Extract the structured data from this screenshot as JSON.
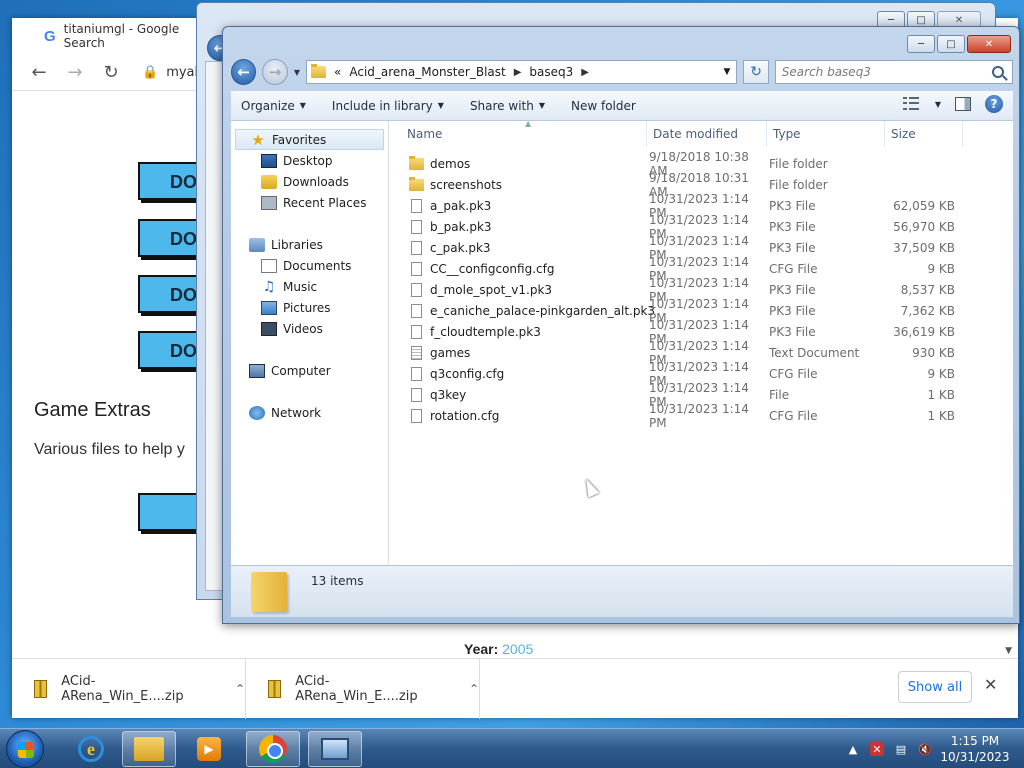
{
  "chrome": {
    "tab_title": "titaniumgl - Google Search",
    "url": "myaba",
    "download_buttons": [
      "DOV",
      "DOV",
      "DOV",
      "DOV"
    ],
    "extras_title": "Game Extras",
    "extras_desc": "Various files to help y",
    "year_label": "Year:",
    "year_value": "2005",
    "downloads": [
      "ACid-ARena_Win_E....zip",
      "ACid-ARena_Win_E....zip"
    ],
    "show_all": "Show all"
  },
  "explorer": {
    "breadcrumb": [
      "«",
      "Acid_arena_Monster_Blast",
      "baseq3"
    ],
    "search_placeholder": "Search baseq3",
    "commands": [
      "Organize",
      "Include in library",
      "Share with",
      "New folder"
    ],
    "nav": {
      "favorites": "Favorites",
      "desktop": "Desktop",
      "downloads": "Downloads",
      "recent": "Recent Places",
      "libraries": "Libraries",
      "documents": "Documents",
      "music": "Music",
      "pictures": "Pictures",
      "videos": "Videos",
      "computer": "Computer",
      "network": "Network"
    },
    "columns": {
      "name": "Name",
      "date": "Date modified",
      "type": "Type",
      "size": "Size"
    },
    "files": [
      {
        "name": "demos",
        "date": "9/18/2018 10:38 AM",
        "type": "File folder",
        "size": "",
        "icon": "folder"
      },
      {
        "name": "screenshots",
        "date": "9/18/2018 10:31 AM",
        "type": "File folder",
        "size": "",
        "icon": "folder"
      },
      {
        "name": "a_pak.pk3",
        "date": "10/31/2023 1:14 PM",
        "type": "PK3 File",
        "size": "62,059 KB",
        "icon": "file"
      },
      {
        "name": "b_pak.pk3",
        "date": "10/31/2023 1:14 PM",
        "type": "PK3 File",
        "size": "56,970 KB",
        "icon": "file"
      },
      {
        "name": "c_pak.pk3",
        "date": "10/31/2023 1:14 PM",
        "type": "PK3 File",
        "size": "37,509 KB",
        "icon": "file"
      },
      {
        "name": "CC__configconfig.cfg",
        "date": "10/31/2023 1:14 PM",
        "type": "CFG File",
        "size": "9 KB",
        "icon": "file"
      },
      {
        "name": "d_mole_spot_v1.pk3",
        "date": "10/31/2023 1:14 PM",
        "type": "PK3 File",
        "size": "8,537 KB",
        "icon": "file"
      },
      {
        "name": "e_caniche_palace-pinkgarden_alt.pk3",
        "date": "10/31/2023 1:14 PM",
        "type": "PK3 File",
        "size": "7,362 KB",
        "icon": "file"
      },
      {
        "name": "f_cloudtemple.pk3",
        "date": "10/31/2023 1:14 PM",
        "type": "PK3 File",
        "size": "36,619 KB",
        "icon": "file"
      },
      {
        "name": "games",
        "date": "10/31/2023 1:14 PM",
        "type": "Text Document",
        "size": "930 KB",
        "icon": "text"
      },
      {
        "name": "q3config.cfg",
        "date": "10/31/2023 1:14 PM",
        "type": "CFG File",
        "size": "9 KB",
        "icon": "file"
      },
      {
        "name": "q3key",
        "date": "10/31/2023 1:14 PM",
        "type": "File",
        "size": "1 KB",
        "icon": "file"
      },
      {
        "name": "rotation.cfg",
        "date": "10/31/2023 1:14 PM",
        "type": "CFG File",
        "size": "1 KB",
        "icon": "file"
      }
    ],
    "item_count": "13 items"
  },
  "taskbar": {
    "time": "1:15 PM",
    "date": "10/31/2023"
  }
}
